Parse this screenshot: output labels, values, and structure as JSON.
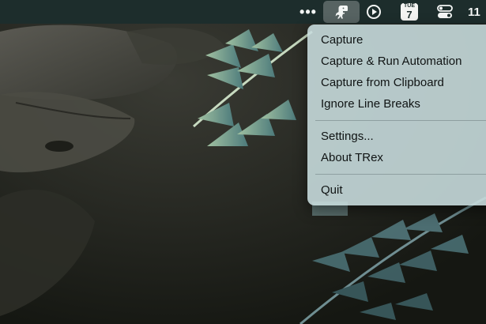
{
  "menubar": {
    "more_label": "•••",
    "clock_label": "11",
    "calendar": {
      "weekday": "TUE",
      "day": "7"
    },
    "icons": [
      "more-icon",
      "trex-icon",
      "play-icon",
      "calendar-icon",
      "control-center-icon"
    ]
  },
  "menu": {
    "items": [
      {
        "label": "Capture"
      },
      {
        "label": "Capture & Run Automation"
      },
      {
        "label": "Capture from Clipboard"
      },
      {
        "label": "Ignore Line Breaks"
      },
      {
        "label": "Settings..."
      },
      {
        "label": "About TRex"
      },
      {
        "label": "Quit"
      }
    ]
  },
  "colors": {
    "menubar_bg": "#1d2d2c",
    "menu_bg": "#c6dadc",
    "menu_text": "#101414"
  }
}
